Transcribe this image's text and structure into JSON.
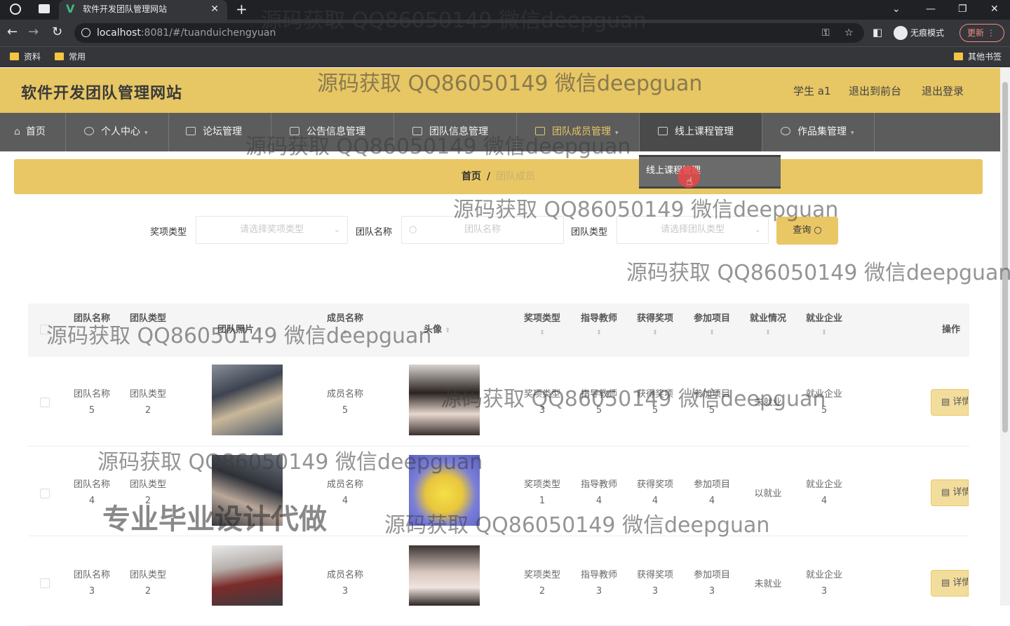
{
  "browser": {
    "tab_title": "软件开发团队管理网站",
    "url_host": "localhost",
    "url_rest": ":8081/#/tuanduichengyuan",
    "incognito_label": "无痕模式",
    "update_label": "更新",
    "bookmarks": [
      "资料",
      "常用"
    ],
    "other_bookmarks": "其他书签"
  },
  "header": {
    "site_title": "软件开发团队管理网站",
    "user": "学生 a1",
    "back_front": "退出到前台",
    "logout": "退出登录"
  },
  "nav": {
    "items": [
      {
        "label": "首页"
      },
      {
        "label": "个人中心"
      },
      {
        "label": "论坛管理"
      },
      {
        "label": "公告信息管理"
      },
      {
        "label": "团队信息管理"
      },
      {
        "label": "团队成员管理"
      },
      {
        "label": "线上课程管理"
      },
      {
        "label": "作品集管理"
      }
    ],
    "dropdown_item": "线上课程管理"
  },
  "breadcrumb": {
    "home": "首页",
    "sep": "/",
    "current": "团队成员"
  },
  "search": {
    "award_label": "奖项类型",
    "award_placeholder": "请选择奖项类型",
    "team_name_label": "团队名称",
    "team_name_placeholder": "团队名称",
    "team_type_label": "团队类型",
    "team_type_placeholder": "请选择团队类型",
    "query_button": "查询"
  },
  "table": {
    "headers": {
      "team_name": "团队名称",
      "team_type": "团队类型",
      "team_photo": "团队照片",
      "member_name": "成员名称",
      "avatar": "头像",
      "award_type": "奖项类型",
      "teacher": "指导教师",
      "awards": "获得奖项",
      "projects": "参加项目",
      "employment": "就业情况",
      "company": "就业企业",
      "actions": "操作"
    },
    "rows": [
      {
        "team_name": "团队名称",
        "team_name_n": "5",
        "team_type": "团队类型",
        "team_type_n": "2",
        "member_name": "成员名称",
        "member_name_n": "5",
        "award_type": "奖项类型",
        "award_type_n": "3",
        "teacher": "指导教师",
        "teacher_n": "5",
        "awards": "获得奖项",
        "awards_n": "5",
        "projects": "参加项目",
        "projects_n": "5",
        "employment": "未就业",
        "company": "就业企业",
        "company_n": "5",
        "detail": "详情"
      },
      {
        "team_name": "团队名称",
        "team_name_n": "4",
        "team_type": "团队类型",
        "team_type_n": "2",
        "member_name": "成员名称",
        "member_name_n": "4",
        "award_type": "奖项类型",
        "award_type_n": "1",
        "teacher": "指导教师",
        "teacher_n": "4",
        "awards": "获得奖项",
        "awards_n": "4",
        "projects": "参加项目",
        "projects_n": "4",
        "employment": "以就业",
        "company": "就业企业",
        "company_n": "4",
        "detail": "详情"
      },
      {
        "team_name": "团队名称",
        "team_name_n": "3",
        "team_type": "团队类型",
        "team_type_n": "2",
        "member_name": "成员名称",
        "member_name_n": "3",
        "award_type": "奖项类型",
        "award_type_n": "2",
        "teacher": "指导教师",
        "teacher_n": "3",
        "awards": "获得奖项",
        "awards_n": "3",
        "projects": "参加项目",
        "projects_n": "3",
        "employment": "未就业",
        "company": "就业企业",
        "company_n": "3",
        "detail": "详情"
      }
    ]
  },
  "watermarks": {
    "text": "源码获取 QQ86050149 微信deepguan",
    "big": "专业毕业设计代做"
  },
  "colors": {
    "accent": "#e7c664",
    "nav": "#5c5c5c"
  }
}
